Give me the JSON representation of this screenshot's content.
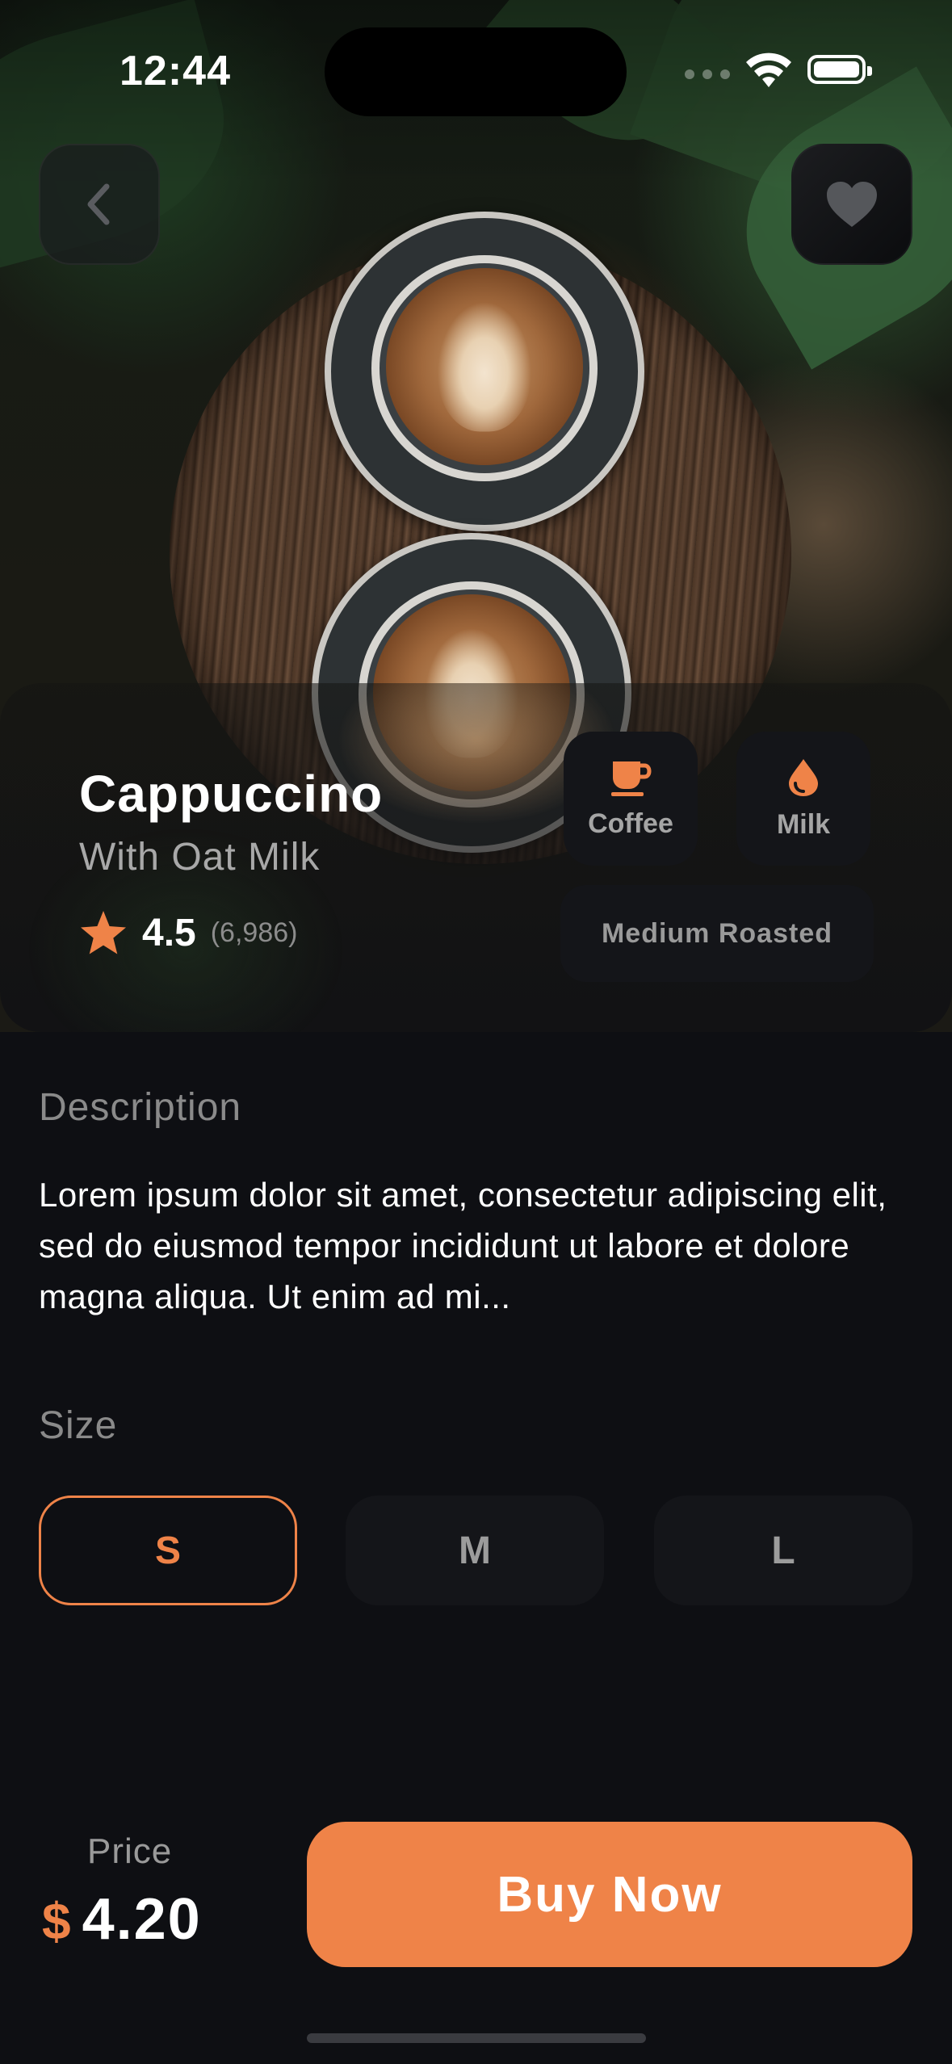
{
  "status_bar": {
    "time": "12:44"
  },
  "product": {
    "name": "Cappuccino",
    "subtitle": "With Oat Milk",
    "rating": "4.5",
    "rating_count": "(6,986)",
    "tags": [
      {
        "label": "Coffee",
        "icon": "coffee-cup-icon"
      },
      {
        "label": "Milk",
        "icon": "milk-drop-icon"
      }
    ],
    "roast": "Medium Roasted"
  },
  "description": {
    "heading": "Description",
    "text": "Lorem ipsum dolor sit amet, consectetur adipiscing elit, sed do eiusmod tempor incididunt ut labore et dolore magna aliqua. Ut enim ad mi..."
  },
  "size": {
    "heading": "Size",
    "options": [
      "S",
      "M",
      "L"
    ],
    "selected": "S"
  },
  "checkout": {
    "price_label": "Price",
    "currency": "$",
    "price": "4.20",
    "buy_label": "Buy Now"
  },
  "colors": {
    "accent": "#ef8348",
    "background": "#0e0f13",
    "chip": "#141519"
  }
}
